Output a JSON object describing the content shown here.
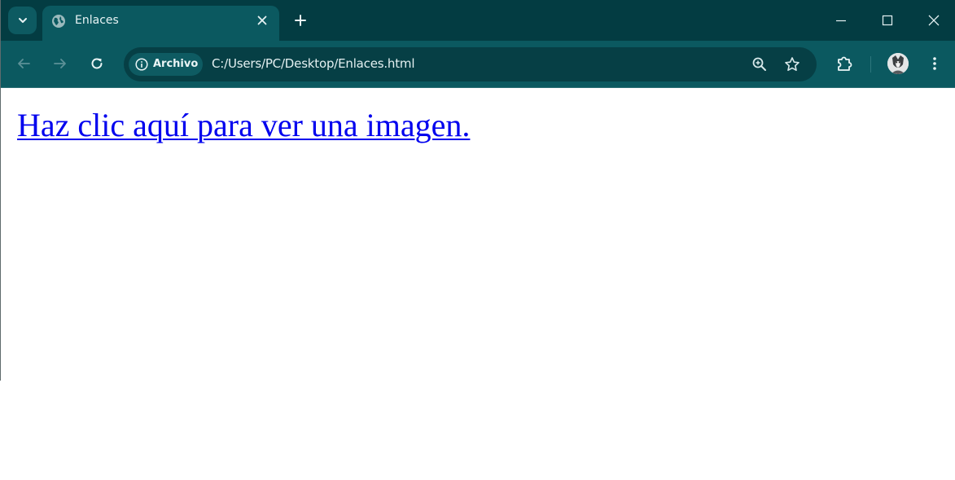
{
  "browser": {
    "tab": {
      "title": "Enlaces",
      "favicon": "globe-icon"
    },
    "new_tab_icon": "plus-icon",
    "window_controls": [
      "minimize-icon",
      "maximize-icon",
      "close-icon"
    ],
    "toolbar": {
      "site_info_label": "Archivo",
      "url": "C:/Users/PC/Desktop/Enlaces.html"
    },
    "colors": {
      "tabstrip": "#033c42",
      "toolbar": "#0b5960",
      "omnibox": "#063f45",
      "link": "#0000ee"
    }
  },
  "page": {
    "link_text": "Haz clic aquí para ver una imagen."
  }
}
